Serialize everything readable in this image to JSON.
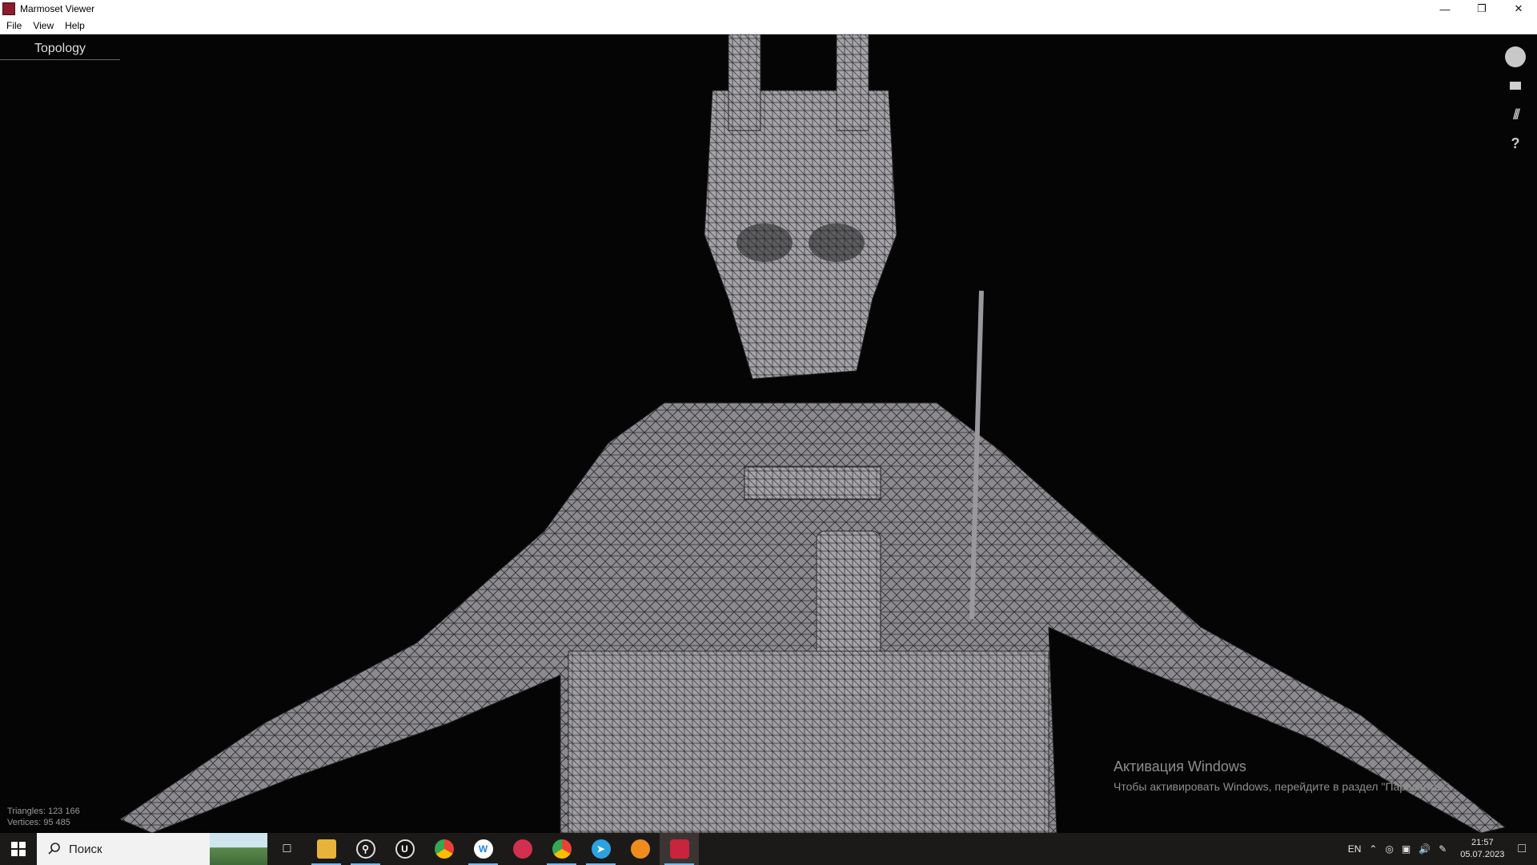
{
  "window": {
    "title": "Marmoset Viewer",
    "controls": [
      "minimize-icon",
      "restore-icon",
      "close-icon"
    ]
  },
  "menu": {
    "items": [
      "File",
      "View",
      "Help"
    ]
  },
  "viewport": {
    "tab_label": "Topology",
    "stats": {
      "triangles": "Triangles: 123 166",
      "vertices": "Vertices: 95 485"
    },
    "side_tools": [
      "avatar-icon",
      "screen-icon",
      "material-icon",
      "help-icon"
    ],
    "help_glyph": "?"
  },
  "activation": {
    "title": "Активация Windows",
    "subtitle": "Чтобы активировать Windows, перейдите в раздел \"Параметры\"."
  },
  "taskbar": {
    "search_placeholder": "Поиск",
    "apps": [
      {
        "name": "task-view-icon",
        "color": "#1c1a19"
      },
      {
        "name": "file-explorer-icon",
        "color": "#e8b33b"
      },
      {
        "name": "search-app-icon",
        "color": "#3a3a3a"
      },
      {
        "name": "unreal-engine-icon",
        "color": "#222222"
      },
      {
        "name": "chrome-icon",
        "color": "#e94235"
      },
      {
        "name": "wacom-icon",
        "color": "#1e88e5"
      },
      {
        "name": "game-app-icon",
        "color": "#d32f4f"
      },
      {
        "name": "chrome-profile-icon",
        "color": "#e94235"
      },
      {
        "name": "telegram-icon",
        "color": "#2aa3e0"
      },
      {
        "name": "blender-icon",
        "color": "#f08c1e"
      },
      {
        "name": "marmoset-icon",
        "color": "#c8243c"
      }
    ],
    "language": "EN",
    "time": "21:57",
    "date": "05.07.2023"
  }
}
